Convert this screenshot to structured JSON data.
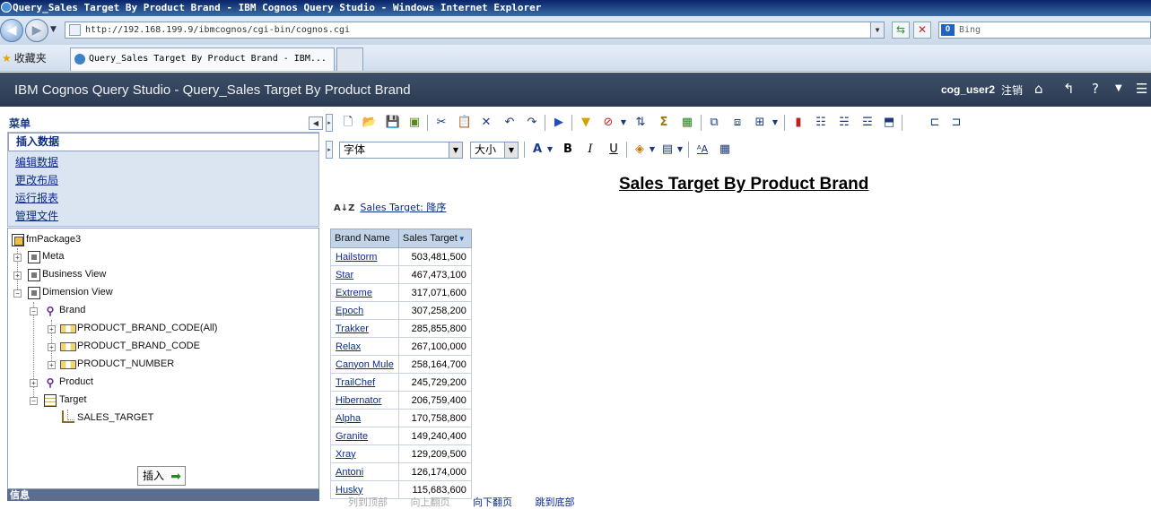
{
  "window": {
    "title": "Query_Sales Target By Product Brand - IBM Cognos Query Studio - Windows Internet Explorer"
  },
  "browser": {
    "url": "http://192.168.199.9/ibmcognos/cgi-bin/cognos.cgi",
    "search_placeholder": "Bing",
    "favorites_label": "收藏夹",
    "tab_title": "Query_Sales Target By Product Brand - IBM..."
  },
  "app": {
    "title": "IBM Cognos Query Studio - Query_Sales Target By Product Brand",
    "user": "cog_user2",
    "logout": "注销"
  },
  "menu": {
    "header": "菜单",
    "items": [
      "插入数据",
      "编辑数据",
      "更改布局",
      "运行报表",
      "管理文件"
    ]
  },
  "tree": {
    "root": "fmPackage3",
    "nodes": {
      "meta": "Meta",
      "business_view": "Business View",
      "dimension_view": "Dimension View",
      "brand": "Brand",
      "code_all": "PRODUCT_BRAND_CODE(All)",
      "code": "PRODUCT_BRAND_CODE",
      "number": "PRODUCT_NUMBER",
      "product": "Product",
      "target": "Target",
      "sales_target": "SALES_TARGET"
    }
  },
  "insert_button": "插入",
  "info_panel": "信息",
  "format_toolbar": {
    "font": "字体",
    "size": "大小"
  },
  "report": {
    "title": "Sales Target By Product Brand",
    "sort_label": "Sales Target: 降序",
    "columns": [
      "Brand Name",
      "Sales Target"
    ],
    "rows": [
      {
        "brand": "Hailstorm",
        "value": "503,481,500"
      },
      {
        "brand": "Star",
        "value": "467,473,100"
      },
      {
        "brand": "Extreme",
        "value": "317,071,600"
      },
      {
        "brand": "Epoch",
        "value": "307,258,200"
      },
      {
        "brand": "Trakker",
        "value": "285,855,800"
      },
      {
        "brand": "Relax",
        "value": "267,100,000"
      },
      {
        "brand": "Canyon Mule",
        "value": "258,164,700"
      },
      {
        "brand": "TrailChef",
        "value": "245,729,200"
      },
      {
        "brand": "Hibernator",
        "value": "206,759,400"
      },
      {
        "brand": "Alpha",
        "value": "170,758,800"
      },
      {
        "brand": "Granite",
        "value": "149,240,400"
      },
      {
        "brand": "Xray",
        "value": "129,209,500"
      },
      {
        "brand": "Antoni",
        "value": "126,174,000"
      },
      {
        "brand": "Husky",
        "value": "115,683,600"
      }
    ]
  },
  "pager": {
    "top": "列到顶部",
    "up": "向上翻页",
    "down": "向下翻页",
    "bottom": "跳到底部"
  }
}
